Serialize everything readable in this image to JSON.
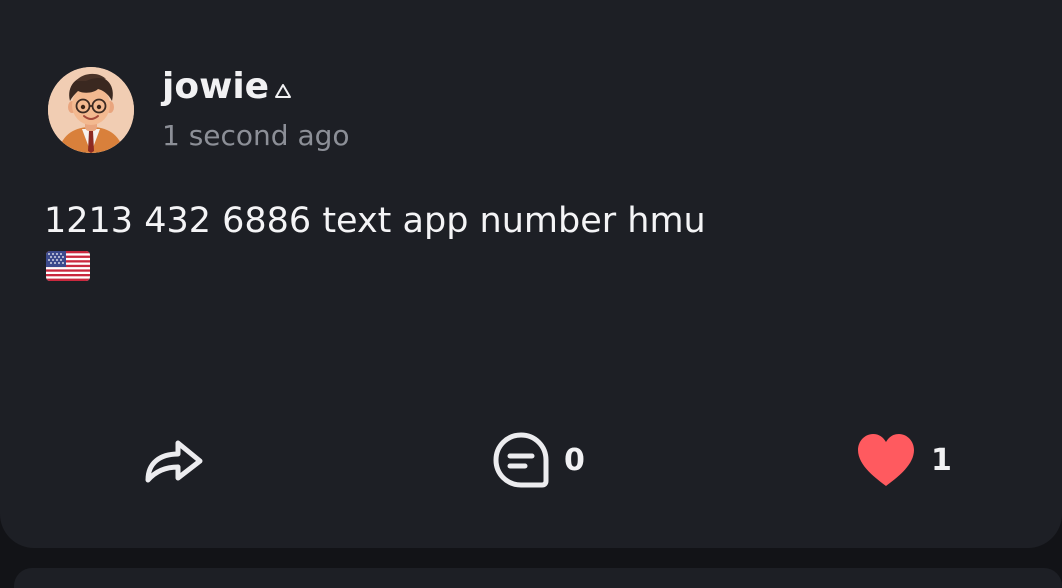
{
  "post": {
    "author": {
      "username": "jowie",
      "avatar": "cartoon-boy-avatar",
      "badge_icon": "triangle-badge-icon"
    },
    "timestamp": "1 second ago",
    "text": "1213 432 6886 text app number hmu",
    "emoji": "us-flag-emoji"
  },
  "actions": {
    "share": {
      "icon": "share-arrow-icon"
    },
    "comment": {
      "icon": "comment-bubble-icon",
      "count": "0"
    },
    "like": {
      "icon": "heart-icon",
      "count": "1",
      "color": "#ff5a5f",
      "liked": true
    }
  },
  "colors": {
    "card_bg": "#1d1f25",
    "page_bg": "#121317",
    "text_primary": "#f1f1f3",
    "text_secondary": "#8c8f97",
    "like_accent": "#ff5a5f"
  }
}
